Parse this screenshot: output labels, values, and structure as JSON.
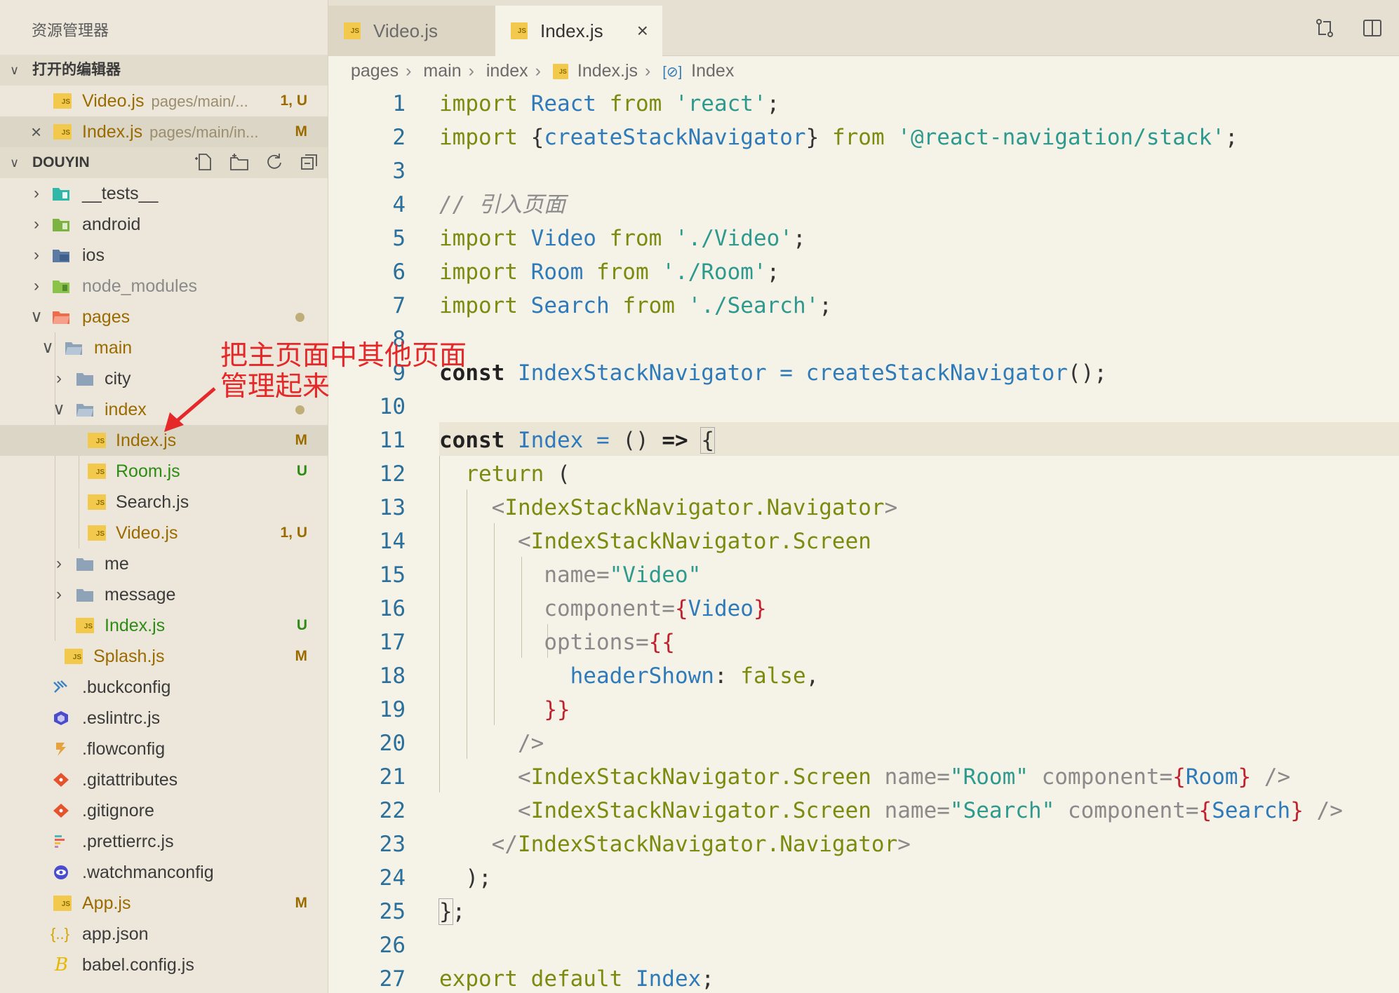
{
  "sidebar": {
    "title": "资源管理器",
    "open_editors": {
      "label": "打开的编辑器",
      "items": [
        {
          "name": "Video.js",
          "path": "pages/main/...",
          "status": "1, U"
        },
        {
          "name": "Index.js",
          "path": "pages/main/in...",
          "status": "M"
        }
      ]
    },
    "project": {
      "label": "DOUYIN",
      "items": [
        {
          "name": "__tests__",
          "status": ""
        },
        {
          "name": "android",
          "status": ""
        },
        {
          "name": "ios",
          "status": ""
        },
        {
          "name": "node_modules",
          "status": ""
        },
        {
          "name": "pages",
          "status": ""
        },
        {
          "name": "main",
          "status": ""
        },
        {
          "name": "city",
          "status": ""
        },
        {
          "name": "index",
          "status": ""
        },
        {
          "name": "Index.js",
          "status": "M"
        },
        {
          "name": "Room.js",
          "status": "U"
        },
        {
          "name": "Search.js",
          "status": ""
        },
        {
          "name": "Video.js",
          "status": "1, U"
        },
        {
          "name": "me",
          "status": ""
        },
        {
          "name": "message",
          "status": ""
        },
        {
          "name": "Index.js",
          "status": "U"
        },
        {
          "name": "Splash.js",
          "status": "M"
        },
        {
          "name": ".buckconfig",
          "status": ""
        },
        {
          "name": ".eslintrc.js",
          "status": ""
        },
        {
          "name": ".flowconfig",
          "status": ""
        },
        {
          "name": ".gitattributes",
          "status": ""
        },
        {
          "name": ".gitignore",
          "status": ""
        },
        {
          "name": ".prettierrc.js",
          "status": ""
        },
        {
          "name": ".watchmanconfig",
          "status": ""
        },
        {
          "name": "App.js",
          "status": "M"
        },
        {
          "name": "app.json",
          "status": ""
        },
        {
          "name": "babel.config.js",
          "status": ""
        }
      ]
    }
  },
  "tabs": [
    {
      "label": "Video.js"
    },
    {
      "label": "Index.js",
      "close": "×"
    }
  ],
  "breadcrumb": [
    "pages",
    "main",
    "index",
    "Index.js",
    "Index"
  ],
  "annotation": {
    "line1": "把主页面中其他页面",
    "line2": "管理起来"
  },
  "colors": {
    "accent_red": "#e5282a",
    "modified": "#9b6b00",
    "untracked": "#2e8b14",
    "js_icon": "#f2c94c"
  },
  "code": {
    "line_numbers": [
      "1",
      "2",
      "3",
      "4",
      "5",
      "6",
      "7",
      "8",
      "9",
      "10",
      "11",
      "12",
      "13",
      "14",
      "15",
      "16",
      "17",
      "18",
      "19",
      "20",
      "21",
      "22",
      "23",
      "24",
      "25",
      "26",
      "27"
    ],
    "t": {
      "import": "import",
      "from": "from",
      "react_id": "React",
      "react_str": "'react'",
      "semi": ";",
      "ob": "{",
      "cb": "}",
      "csn": "createStackNavigator",
      "stack_str": "'@react-navigation/stack'",
      "comment": "// 引入页面",
      "video": "Video",
      "video_str": "'./Video'",
      "room": "Room",
      "room_str": "'./Room'",
      "search": "Search",
      "search_str": "'./Search'",
      "const": "const",
      "isn": "IndexStackNavigator",
      "eq": "=",
      "csn_call": "createStackNavigator",
      "parens": "()",
      "index": "Index",
      "arrow": "=>",
      "return": "return",
      "oparen": "(",
      "cparen": ")",
      "lt": "<",
      "gt": ">",
      "lts": "</",
      "sgt": "/>",
      "isn_nav": "IndexStackNavigator.Navigator",
      "isn_screen": "IndexStackNavigator.Screen",
      "name_attr": "name=",
      "video_val": "\"Video\"",
      "component_attr": "component=",
      "options_attr": "options=",
      "dob": "{{",
      "dcb": "}}",
      "header_shown": "headerShown",
      "colon": ":",
      "false": "false",
      "comma": ",",
      "room_val": "\"Room\"",
      "search_val": "\"Search\"",
      "close_brace_semi_b": "}",
      "export": "export",
      "default": "default"
    }
  }
}
